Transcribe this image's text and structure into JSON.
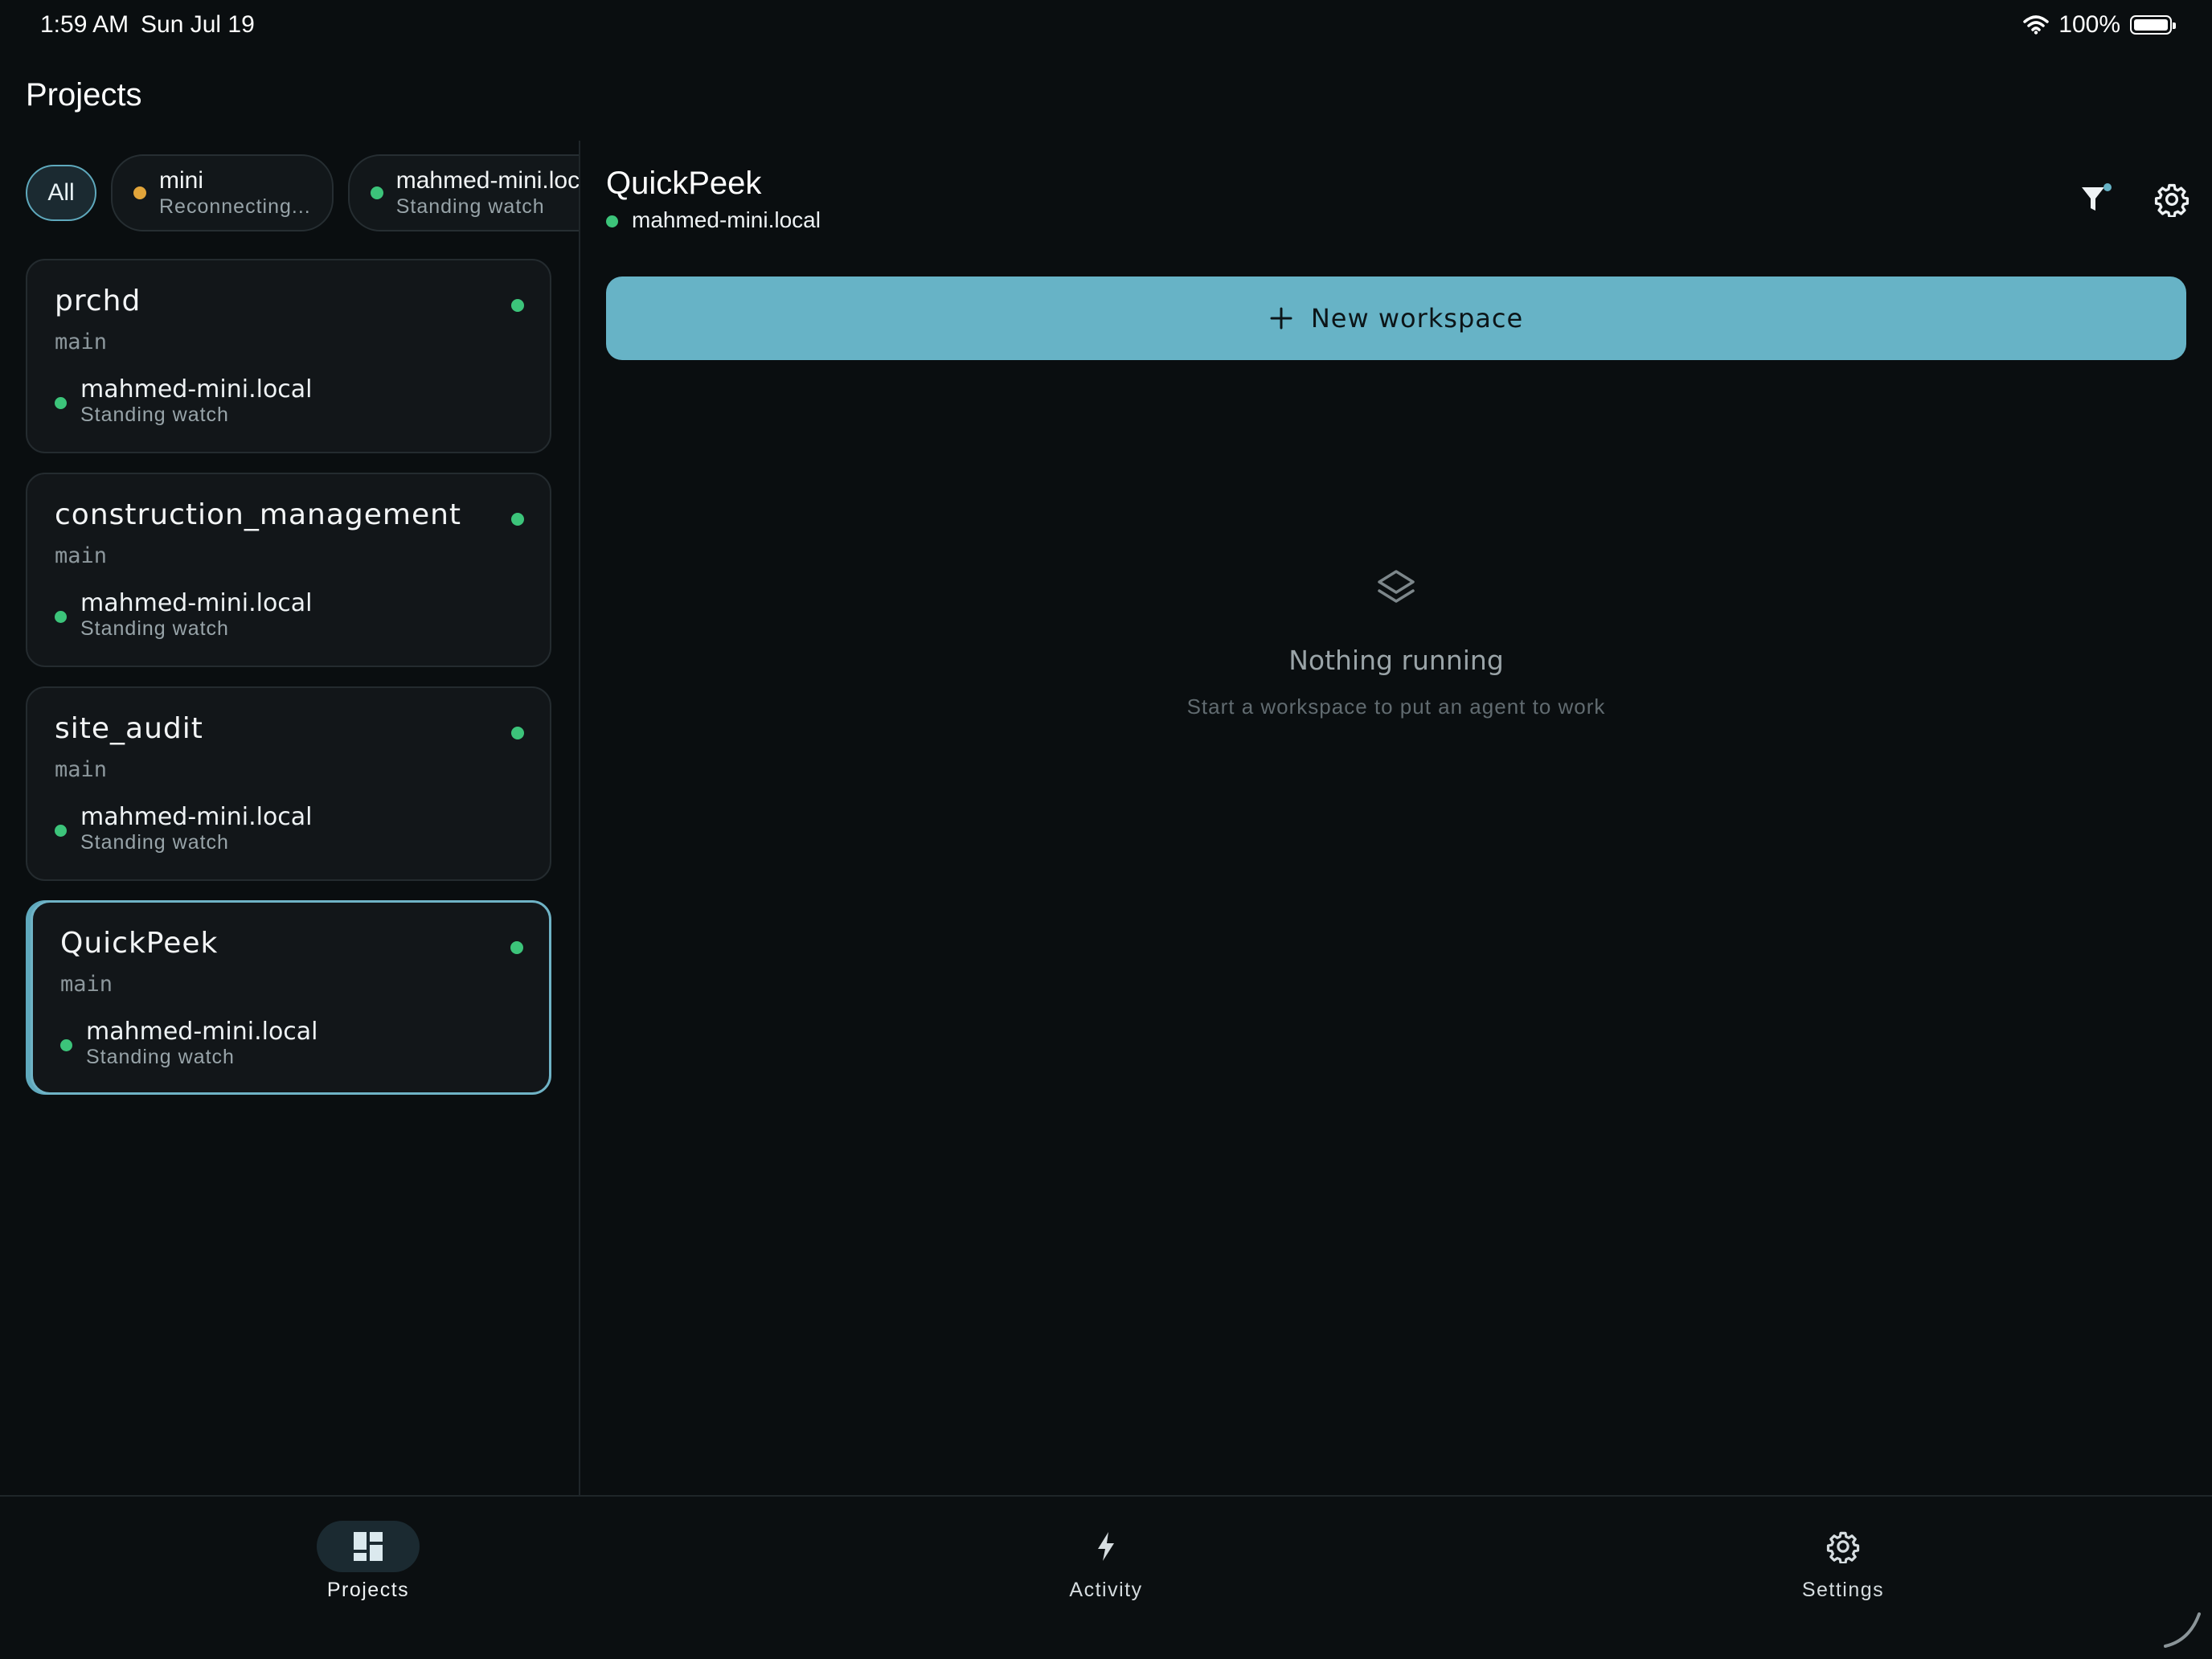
{
  "status_bar": {
    "time": "1:59 AM",
    "date": "Sun Jul 19",
    "battery": "100%"
  },
  "page_title": "Projects",
  "filter_chips": [
    {
      "label": "All",
      "status": "",
      "dot_color": ""
    },
    {
      "label": "mini",
      "status": "Reconnecting...",
      "dot_color": "#e2a53a"
    },
    {
      "label": "mahmed-mini.local",
      "status": "Standing watch",
      "dot_color": "#3cc47a"
    }
  ],
  "projects": [
    {
      "name": "prchd",
      "branch": "main",
      "host": "mahmed-mini.local",
      "host_status": "Standing watch"
    },
    {
      "name": "construction_management",
      "branch": "main",
      "host": "mahmed-mini.local",
      "host_status": "Standing watch"
    },
    {
      "name": "site_audit",
      "branch": "main",
      "host": "mahmed-mini.local",
      "host_status": "Standing watch"
    },
    {
      "name": "QuickPeek",
      "branch": "main",
      "host": "mahmed-mini.local",
      "host_status": "Standing watch"
    }
  ],
  "detail": {
    "title": "QuickPeek",
    "host": "mahmed-mini.local",
    "new_workspace_label": "New workspace",
    "empty_title": "Nothing running",
    "empty_subtitle": "Start a workspace to put an agent to work"
  },
  "tabs": [
    {
      "label": "Projects",
      "icon": "dashboard-icon"
    },
    {
      "label": "Activity",
      "icon": "bolt-icon"
    },
    {
      "label": "Settings",
      "icon": "gear-icon"
    }
  ],
  "colors": {
    "accent": "#67b3c6",
    "online": "#3cc47a",
    "reconnecting": "#e2a53a",
    "background": "#0a0e10"
  }
}
